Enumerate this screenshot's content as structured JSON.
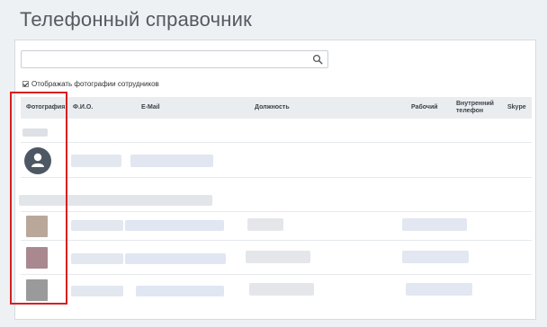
{
  "page": {
    "title": "Телефонный справочник"
  },
  "search": {
    "placeholder": "",
    "value": ""
  },
  "options": {
    "show_photos_label": "Отображать фотографии сотрудников",
    "show_photos_checked": true
  },
  "table": {
    "headers": {
      "photo": "Фотография",
      "fio": "Ф.И.О.",
      "email": "E-Mail",
      "position": "Должность",
      "work_phone": "Рабочий",
      "internal_phone": "Внутренний телефон",
      "skype": "Skype"
    }
  },
  "icons": {
    "search": "search-icon",
    "avatar_placeholder": "user-silhouette-icon"
  },
  "colors": {
    "highlight": "#d62020",
    "header_bg": "#eaedf0",
    "page_bg": "#eef1f4",
    "avatar_bg": "#4e5864"
  }
}
